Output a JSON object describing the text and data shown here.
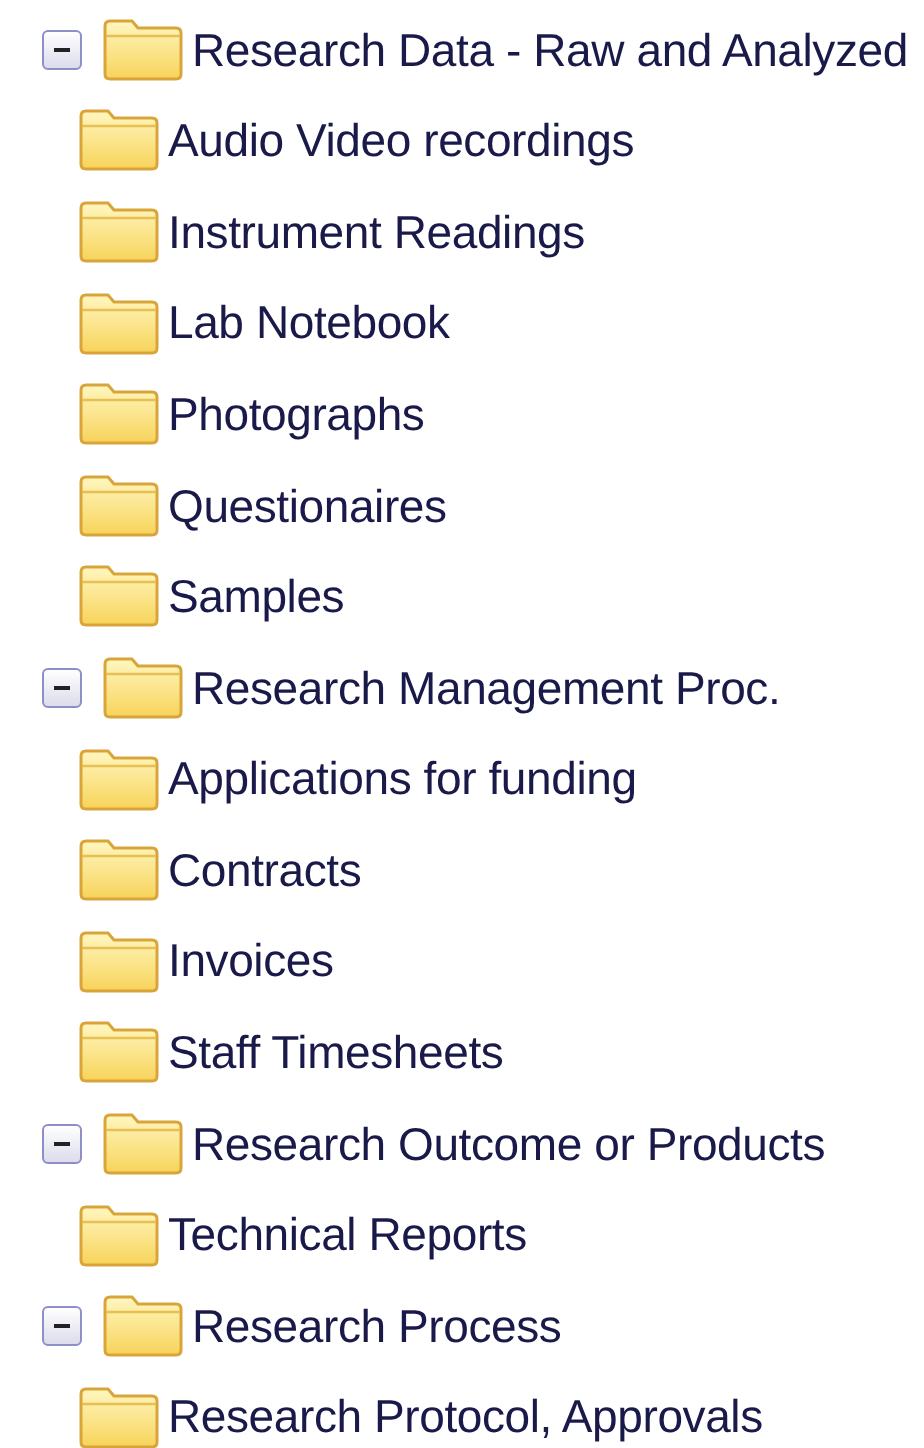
{
  "tree": [
    {
      "label": "Research Data - Raw and Analyzed",
      "expanded": true,
      "children": [
        {
          "label": "Audio Video recordings"
        },
        {
          "label": "Instrument Readings"
        },
        {
          "label": "Lab Notebook"
        },
        {
          "label": "Photographs"
        },
        {
          "label": "Questionaires"
        },
        {
          "label": "Samples"
        }
      ]
    },
    {
      "label": "Research Management Proc.",
      "expanded": true,
      "children": [
        {
          "label": "Applications for funding"
        },
        {
          "label": "Contracts"
        },
        {
          "label": "Invoices"
        },
        {
          "label": "Staff Timesheets"
        }
      ]
    },
    {
      "label": "Research Outcome or Products",
      "expanded": true,
      "children": [
        {
          "label": "Technical Reports"
        }
      ]
    },
    {
      "label": "Research Process",
      "expanded": true,
      "children": [
        {
          "label": "Research Protocol, Approvals"
        }
      ]
    }
  ]
}
